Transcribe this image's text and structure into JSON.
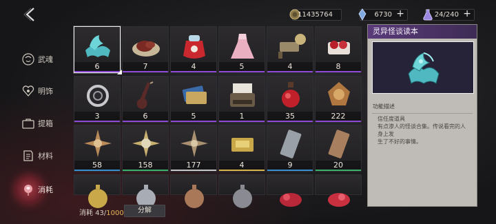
{
  "currencies": [
    {
      "id": "gold",
      "icon": "gold-coin-icon",
      "value": "11435764",
      "has_plus": false
    },
    {
      "id": "crystal",
      "icon": "crystal-icon",
      "value": "6730",
      "has_plus": true
    },
    {
      "id": "stamina",
      "icon": "stamina-flask-icon",
      "value": "24/240",
      "has_plus": true
    }
  ],
  "sidebar": {
    "items": [
      {
        "label": "武魂",
        "icon": "spirit-mask-icon",
        "active": false
      },
      {
        "label": "明饰",
        "icon": "heart-ornament-icon",
        "active": false
      },
      {
        "label": "提箱",
        "icon": "case-icon",
        "active": false
      },
      {
        "label": "材料",
        "icon": "material-scroll-icon",
        "active": false
      },
      {
        "label": "消耗",
        "icon": "consumable-rose-icon",
        "active": true
      }
    ]
  },
  "items": [
    {
      "name": "strange-tales-book",
      "count": "6",
      "rarity": "#8e4ad6",
      "selected": true
    },
    {
      "name": "steak-plate",
      "count": "7",
      "rarity": "#8e4ad6",
      "selected": false
    },
    {
      "name": "red-pouch",
      "count": "4",
      "rarity": "#8e4ad6",
      "selected": false
    },
    {
      "name": "pink-dress",
      "count": "5",
      "rarity": "#8e4ad6",
      "selected": false
    },
    {
      "name": "film-projector",
      "count": "4",
      "rarity": "#8e4ad6",
      "selected": false
    },
    {
      "name": "gift-sweets",
      "count": "8",
      "rarity": "#8e4ad6",
      "selected": false
    },
    {
      "name": "rose-brooch",
      "count": "3",
      "rarity": "#8e4ad6",
      "selected": false
    },
    {
      "name": "violin",
      "count": "6",
      "rarity": "#8e4ad6",
      "selected": false
    },
    {
      "name": "ticket-cards",
      "count": "5",
      "rarity": "#8e4ad6",
      "selected": false
    },
    {
      "name": "typewriter",
      "count": "1",
      "rarity": "#8e4ad6",
      "selected": false
    },
    {
      "name": "red-potion",
      "count": "35",
      "rarity": "#8e4ad6",
      "selected": false
    },
    {
      "name": "bronze-medal",
      "count": "222",
      "rarity": "#8e4ad6",
      "selected": false
    },
    {
      "name": "bronze-star-emblem",
      "count": "58",
      "rarity": "#3a8fd0",
      "selected": false
    },
    {
      "name": "green-star-emblem",
      "count": "158",
      "rarity": "#3ab06a",
      "selected": false
    },
    {
      "name": "silver-star-emblem",
      "count": "177",
      "rarity": "#c8c8c8",
      "selected": false
    },
    {
      "name": "gold-ingot",
      "count": "4",
      "rarity": "#d6b44a",
      "selected": false
    },
    {
      "name": "silver-bar",
      "count": "9",
      "rarity": "#3a8fd0",
      "selected": false
    },
    {
      "name": "bronze-bar",
      "count": "20",
      "rarity": "#3ab06a",
      "selected": false
    },
    {
      "name": "gold-pocket-watch",
      "count": "",
      "rarity": "",
      "selected": false
    },
    {
      "name": "silver-pocket-watch",
      "count": "",
      "rarity": "",
      "selected": false
    },
    {
      "name": "bronze-pocket-watch",
      "count": "",
      "rarity": "",
      "selected": false
    },
    {
      "name": "dark-pocket-watch",
      "count": "",
      "rarity": "",
      "selected": false
    },
    {
      "name": "red-rose-gem",
      "count": "",
      "rarity": "",
      "selected": false
    },
    {
      "name": "crimson-rose-gem",
      "count": "",
      "rarity": "",
      "selected": false
    }
  ],
  "bottom": {
    "usage_label": "消耗 43/",
    "usage_max": "10000",
    "decompose_label": "分解"
  },
  "detail": {
    "title": "灵异怪谈读本",
    "section_label": "功能描述",
    "desc_line1": "信任度道具",
    "desc_line2": "有点渗人的怪谈合集。传说看完的人身上发",
    "desc_line3": "生了不好的事情。"
  },
  "colors": {
    "accent_purple": "#8e4ad6",
    "panel_header": "#5a3a7a",
    "active_tab": "#a33a45"
  }
}
